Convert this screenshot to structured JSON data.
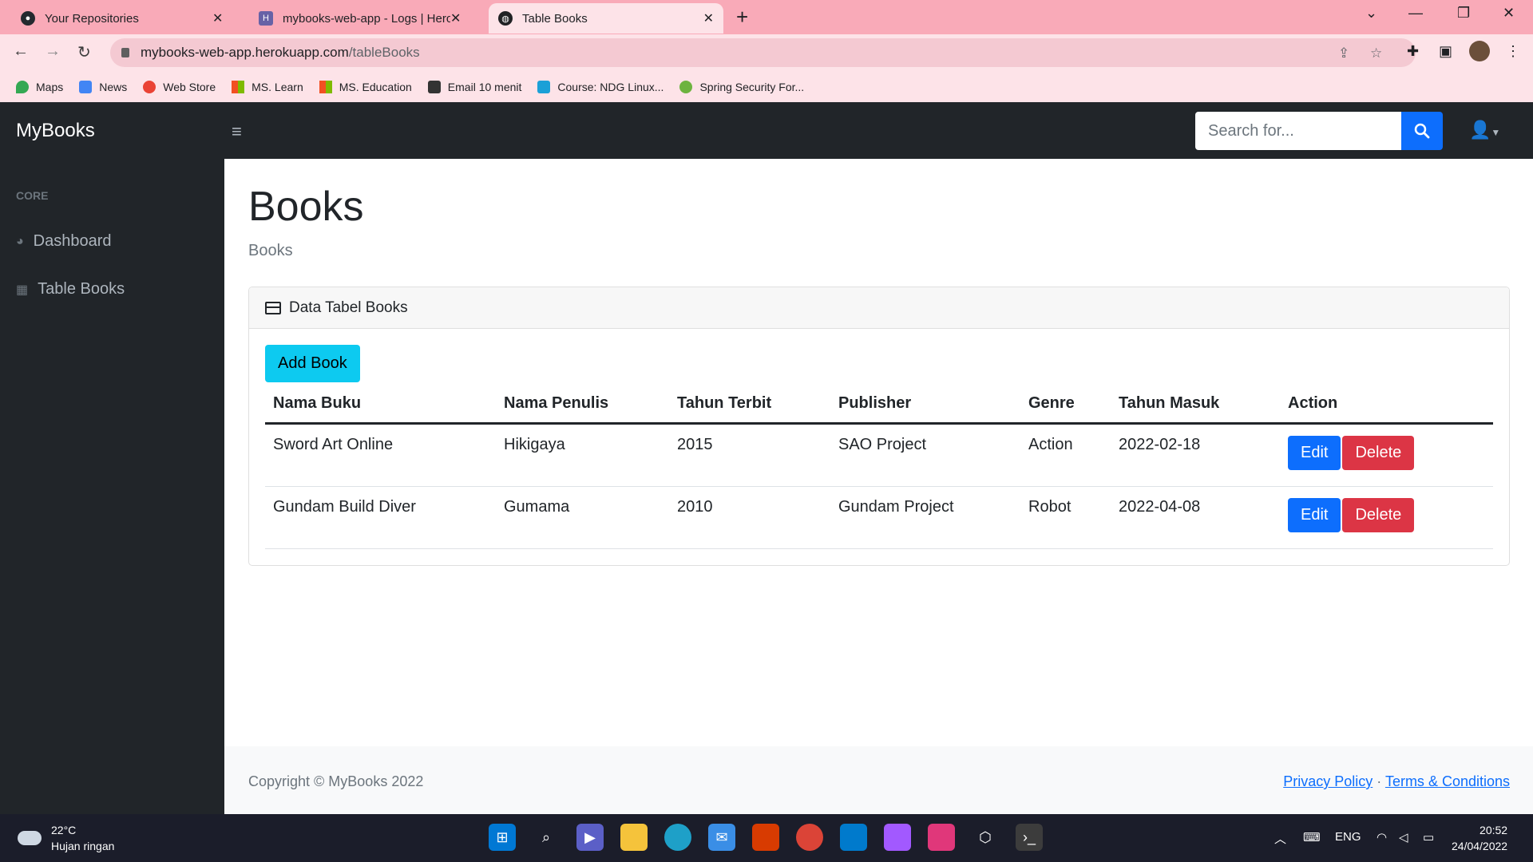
{
  "browser": {
    "tabs": [
      {
        "title": "Your Repositories",
        "icon": "github-icon"
      },
      {
        "title": "mybooks-web-app - Logs | Herok",
        "icon": "heroku-icon"
      },
      {
        "title": "Table Books",
        "icon": "globe-icon"
      }
    ],
    "url_host": "mybooks-web-app.herokuapp.com",
    "url_path": "/tableBooks",
    "bookmarks": [
      "Maps",
      "News",
      "Web Store",
      "MS. Learn",
      "MS. Education",
      "Email 10 menit",
      "Course: NDG Linux...",
      "Spring Security For..."
    ]
  },
  "navbar": {
    "brand": "MyBooks",
    "search_placeholder": "Search for..."
  },
  "sidebar": {
    "heading": "CORE",
    "items": [
      {
        "label": "Dashboard",
        "icon": "dashboard-icon"
      },
      {
        "label": "Table Books",
        "icon": "table-icon"
      }
    ]
  },
  "page": {
    "title": "Books",
    "breadcrumb": "Books",
    "card_title": "Data Tabel Books",
    "add_button": "Add Book",
    "columns": [
      "Nama Buku",
      "Nama Penulis",
      "Tahun Terbit",
      "Publisher",
      "Genre",
      "Tahun Masuk",
      "Action"
    ],
    "rows": [
      [
        "Sword Art Online",
        "Hikigaya",
        "2015",
        "SAO Project",
        "Action",
        "2022-02-18"
      ],
      [
        "Gundam Build Diver",
        "Gumama",
        "2010",
        "Gundam Project",
        "Robot",
        "2022-04-08"
      ]
    ],
    "edit_label": "Edit",
    "delete_label": "Delete"
  },
  "footer": {
    "copyright": "Copyright © MyBooks 2022",
    "privacy": "Privacy Policy",
    "separator": "·",
    "terms": "Terms & Conditions"
  },
  "taskbar": {
    "temp": "22°C",
    "weather": "Hujan ringan",
    "lang": "ENG",
    "time": "20:52",
    "date": "24/04/2022"
  },
  "colors": {
    "primary": "#0d6efd",
    "danger": "#dc3545",
    "info": "#0dcaf0",
    "dark": "#212529"
  }
}
